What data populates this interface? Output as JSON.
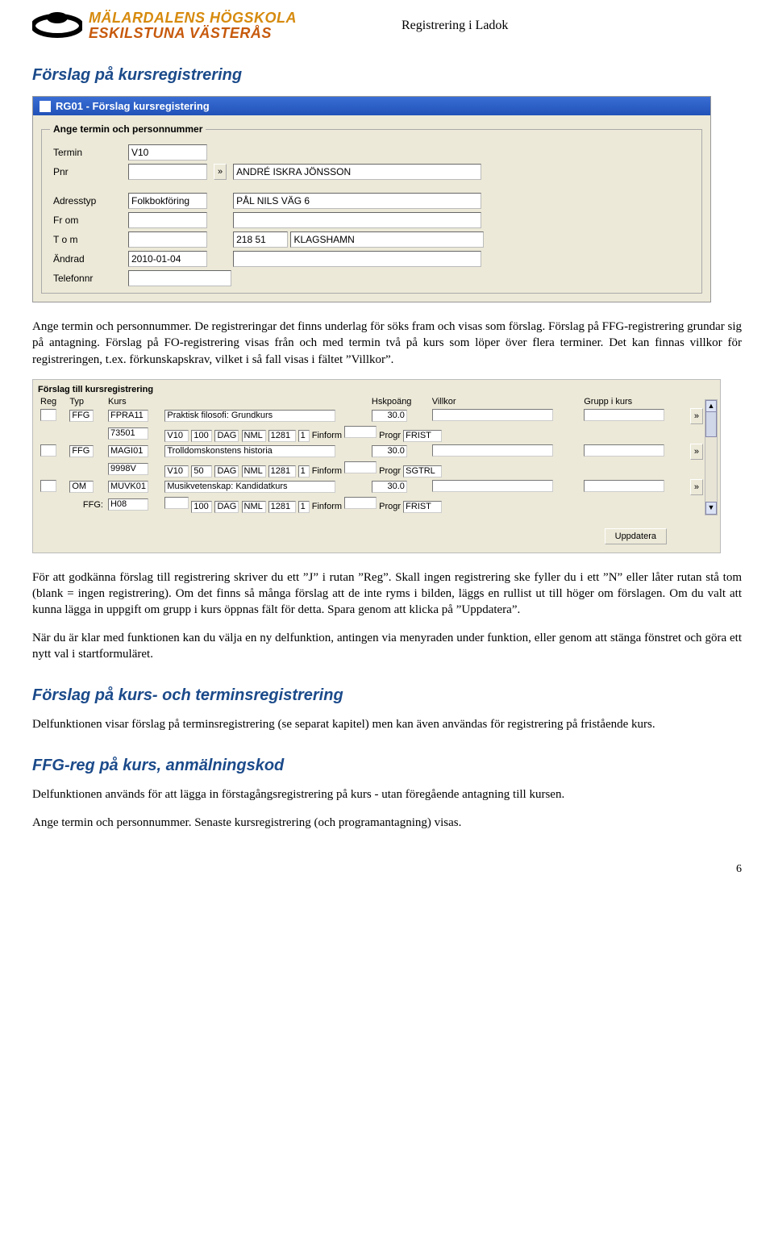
{
  "header": {
    "logo_line1": "MÄLARDALENS HÖGSKOLA",
    "logo_line2": "ESKILSTUNA VÄSTERÅS",
    "doc_title": "Registrering i Ladok"
  },
  "section1": {
    "heading": "Förslag på kursregistrering",
    "para1": "Ange termin och personnummer. De registreringar det finns underlag för söks fram och visas som förslag. Förslag på FFG-registrering grundar sig på antagning. Förslag på FO-registrering visas från och med termin två på kurs som löper över flera terminer. Det kan finnas villkor för registreringen, t.ex. förkunskapskrav, vilket i så fall visas i fältet ”Villkor”.",
    "para2": "För att godkänna förslag till registrering skriver du ett ”J” i rutan ”Reg”. Skall ingen registrering ske fyller du i ett ”N” eller låter rutan stå tom (blank = ingen registrering). Om det finns så många förslag att de inte ryms i bilden, läggs en rullist ut till höger om förslagen. Om du valt att kunna lägga in uppgift om grupp i kurs öppnas fält för detta. Spara genom att klicka på ”Uppdatera”.",
    "para3": "När du är klar med funktionen kan du välja en ny delfunktion, antingen via menyraden under funktion, eller genom att stänga fönstret och göra ett nytt val i startformuläret."
  },
  "section2": {
    "heading": "Förslag på kurs- och terminsregistrering",
    "para": "Delfunktionen visar förslag på terminsregistrering (se separat kapitel) men kan även användas för registrering på fristående kurs."
  },
  "section3": {
    "heading": "FFG-reg på kurs, anmälningskod",
    "para1": "Delfunktionen används för att lägga in förstagångsregistrering på kurs - utan föregående antagning till kursen.",
    "para2": "Ange termin och personnummer. Senaste kursregistrering (och programantagning) visas."
  },
  "win1": {
    "title": "RG01 - Förslag kursregistering",
    "legend": "Ange termin och personnummer",
    "labels": {
      "termin": "Termin",
      "pnr": "Pnr",
      "adresstyp": "Adresstyp",
      "frorm": "Fr om",
      "tom": "T o m",
      "andrad": "Ändrad",
      "telefonnr": "Telefonnr"
    },
    "values": {
      "termin": "V10",
      "pnr_btn": "»",
      "name": "ANDRÉ ISKRA JÖNSSON",
      "adresstyp": "Folkbokföring",
      "street": "PÅL NILS VÄG 6",
      "zip": "218 51",
      "city": "KLAGSHAMN",
      "andrad": "2010-01-04"
    }
  },
  "list": {
    "title": "Förslag till kursregistrering",
    "headers": {
      "reg": "Reg",
      "typ": "Typ",
      "kurs": "Kurs",
      "hsk": "Hskpoäng",
      "villkor": "Villkor",
      "grp": "Grupp i kurs"
    },
    "rows": [
      {
        "typ": "FFG",
        "code": "FPRA11",
        "name": "Praktisk filosofi: Grundkurs",
        "hsk": "30.0",
        "sub": [
          "73501",
          "V10",
          "100",
          "DAG",
          "NML",
          "1281",
          "1",
          "Finform",
          "Progr",
          "FRIST"
        ]
      },
      {
        "typ": "FFG",
        "code": "MAGI01",
        "name": "Trolldomskonstens historia",
        "hsk": "30.0",
        "sub": [
          "9998V",
          "V10",
          "50",
          "DAG",
          "NML",
          "1281",
          "1",
          "Finform",
          "Progr",
          "SGTRL"
        ]
      },
      {
        "typ": "OM",
        "code": "MUVK01",
        "name": "Musikvetenskap: Kandidatkurs",
        "hsk": "30.0",
        "sub_prefix": "FFG:",
        "sub": [
          "H08",
          "100",
          "DAG",
          "NML",
          "1281",
          "1",
          "Finform",
          "Progr",
          "FRIST"
        ]
      }
    ],
    "expand": "»",
    "update": "Uppdatera"
  },
  "page_number": "6"
}
